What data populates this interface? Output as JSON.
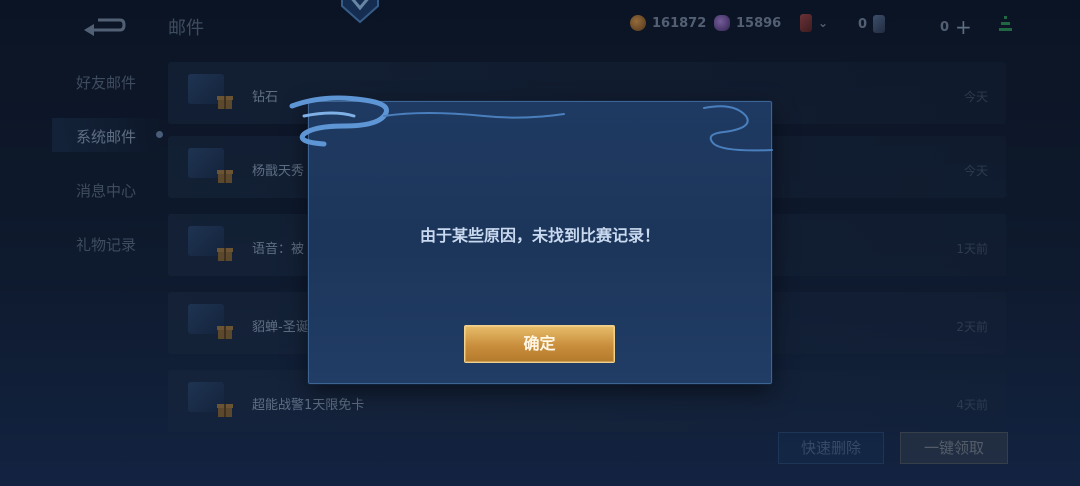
{
  "header": {
    "title": "邮件",
    "resources": {
      "gold": "161872",
      "gems": "15896",
      "card_a": "0",
      "card_b": "0"
    }
  },
  "sidebar": {
    "items": [
      {
        "label": "好友邮件"
      },
      {
        "label": "系统邮件"
      },
      {
        "label": "消息中心"
      },
      {
        "label": "礼物记录"
      }
    ]
  },
  "mails": [
    {
      "title": "钻石",
      "time": "今天"
    },
    {
      "title": "杨戬天秀",
      "time": "今天"
    },
    {
      "title": "语音：被",
      "time": "1天前"
    },
    {
      "title": "貂蝉-圣诞",
      "time": "2天前"
    },
    {
      "title": "超能战警1天限免卡",
      "time": "4天前"
    }
  ],
  "actions": {
    "delete_label": "快速删除",
    "claim_label": "一键领取"
  },
  "dialog": {
    "message": "由于某些原因，未找到比赛记录！",
    "confirm_label": "确定"
  },
  "colors": {
    "accent_gold": "#d9a84f",
    "dialog_bg": "#1f3a62",
    "background": "#13223a"
  }
}
